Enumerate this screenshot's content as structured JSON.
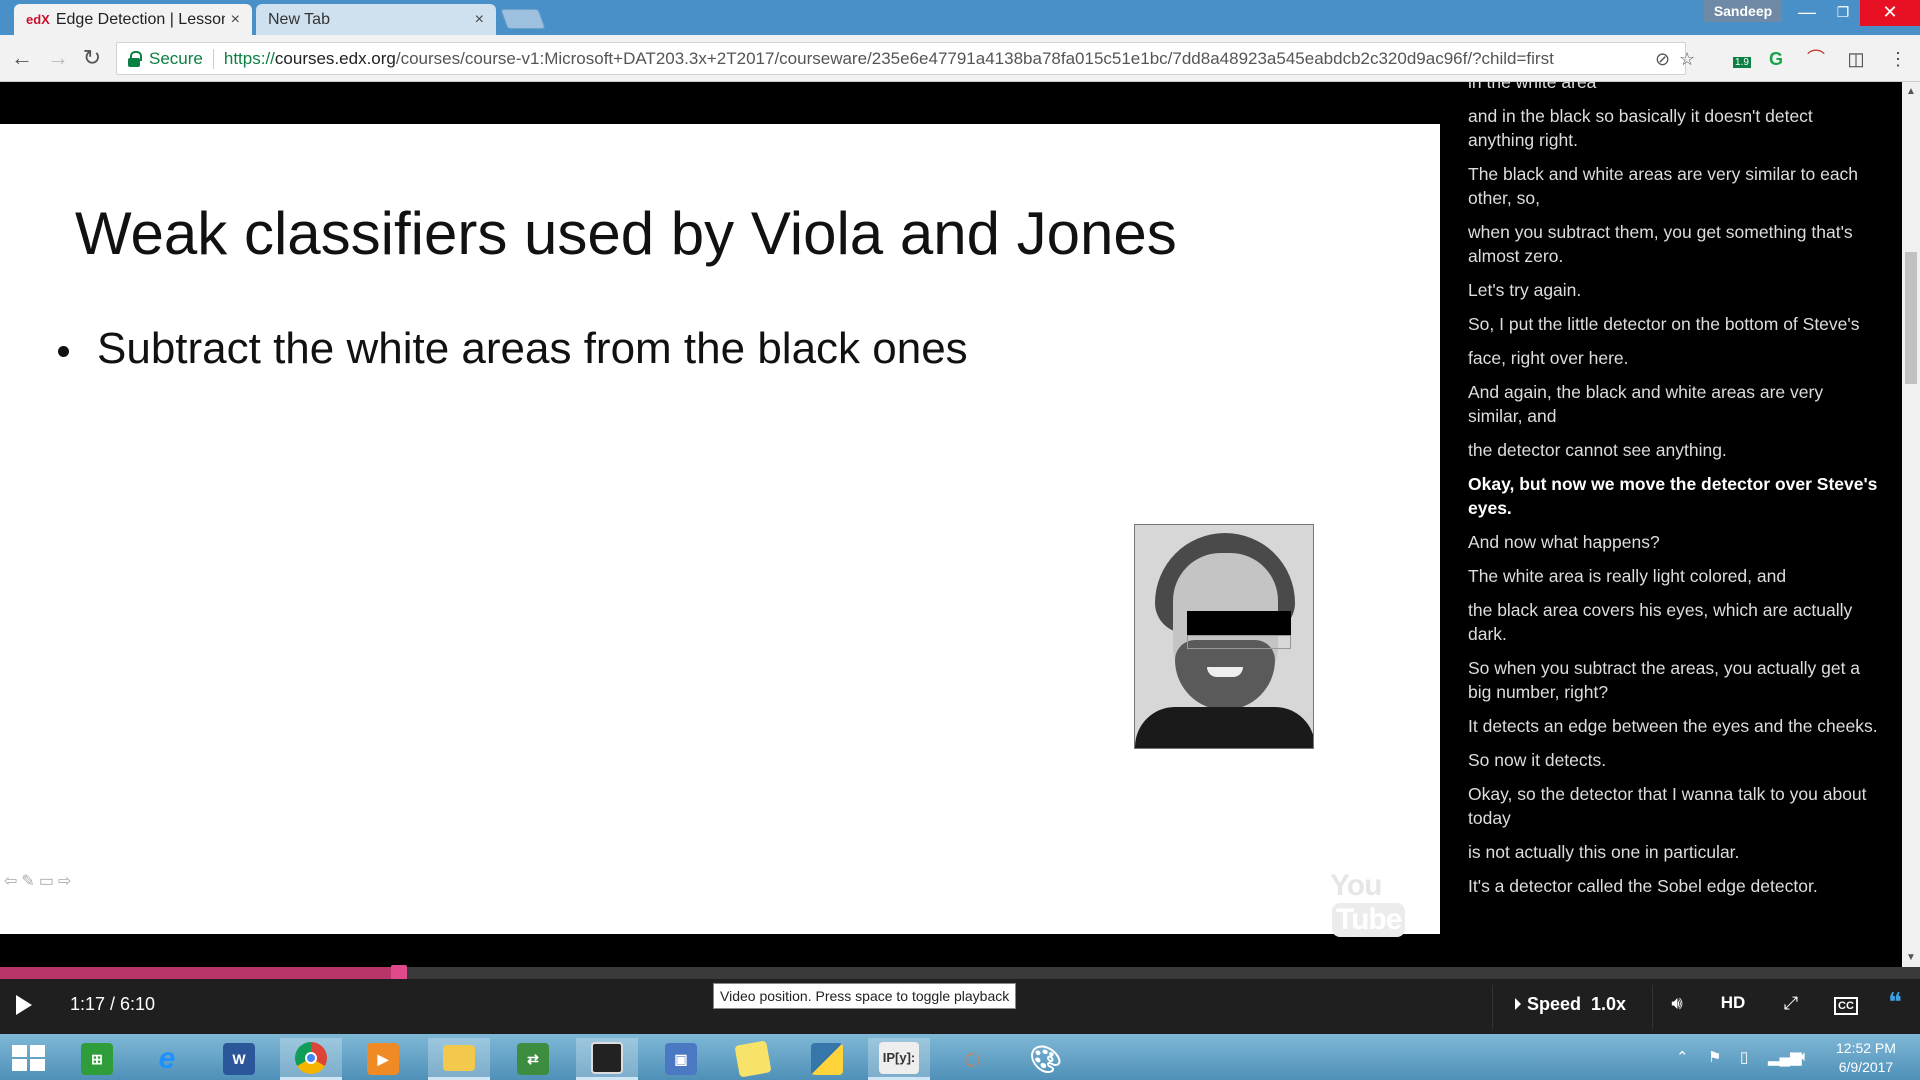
{
  "browser": {
    "tabs": [
      {
        "favicon": "edX",
        "title": "Edge Detection | Lesson",
        "close": "×"
      },
      {
        "title": "New Tab",
        "close": "×"
      }
    ],
    "profile_name": "Sandeep",
    "window_controls": {
      "minimize": "—",
      "maximize": "❐",
      "close": "✕"
    },
    "security_label": "Secure",
    "url": {
      "scheme": "https://",
      "host": "courses.edx.org",
      "path": "/courses/course-v1:Microsoft+DAT203.3x+2T2017/courseware/235e6e47791a4138ba78fa015c51e1bc/7dd8a48923a545eabdcb2c320d9ac96f/?child=first"
    },
    "extension_badge": "1.9"
  },
  "slide": {
    "title": "Weak classifiers used by Viola and Jones",
    "bullet": "Subtract the white areas from the black ones",
    "nav_glyphs": "⇦✎▭⇨",
    "watermark": "You",
    "watermark_box": "Tube"
  },
  "transcript": {
    "lines": [
      "in the white area",
      "and in the black so basically it doesn't detect anything right.",
      "The black and white areas are very similar to each other, so,",
      "when you subtract them, you get something that's almost zero.",
      "Let's try again.",
      "So, I put the little detector on the bottom of Steve's",
      "face, right over here.",
      "And again, the black and white areas are very similar, and",
      "the detector cannot see anything.",
      "Okay, but now we move the detector over Steve's eyes.",
      "And now what happens?",
      "The white area is really light colored, and",
      "the black area covers his eyes, which are actually dark.",
      "So when you subtract the areas, you actually get a big number, right?",
      "It detects an edge between the eyes and the cheeks.",
      "So now it detects.",
      "Okay, so the detector that I wanna talk to you about today",
      "is not actually this one in particular.",
      "It's a detector called the Sobel edge detector."
    ],
    "current_index": 9
  },
  "player": {
    "time": "1:17 / 6:10",
    "progress_fraction": 0.208,
    "tooltip": "Video position. Press space to toggle playback",
    "speed_label": "Speed",
    "speed_value": "1.0x",
    "hd_label": "HD",
    "cc_label": "CC",
    "icons": [
      "volume-icon",
      "hd-icon",
      "fullscreen-icon",
      "captions-icon",
      "transcript-icon"
    ]
  },
  "taskbar": {
    "apps": [
      "windows-start",
      "store",
      "internet-explorer",
      "word",
      "chrome",
      "media-player",
      "file-explorer",
      "remote-tool",
      "terminal",
      "network-tool",
      "sticky-notes",
      "python",
      "ipython",
      "jupyter",
      "paint"
    ],
    "ipython_label": "IP[y]:",
    "word_label": "W",
    "clock_time": "12:52 PM",
    "clock_date": "6/9/2017"
  }
}
